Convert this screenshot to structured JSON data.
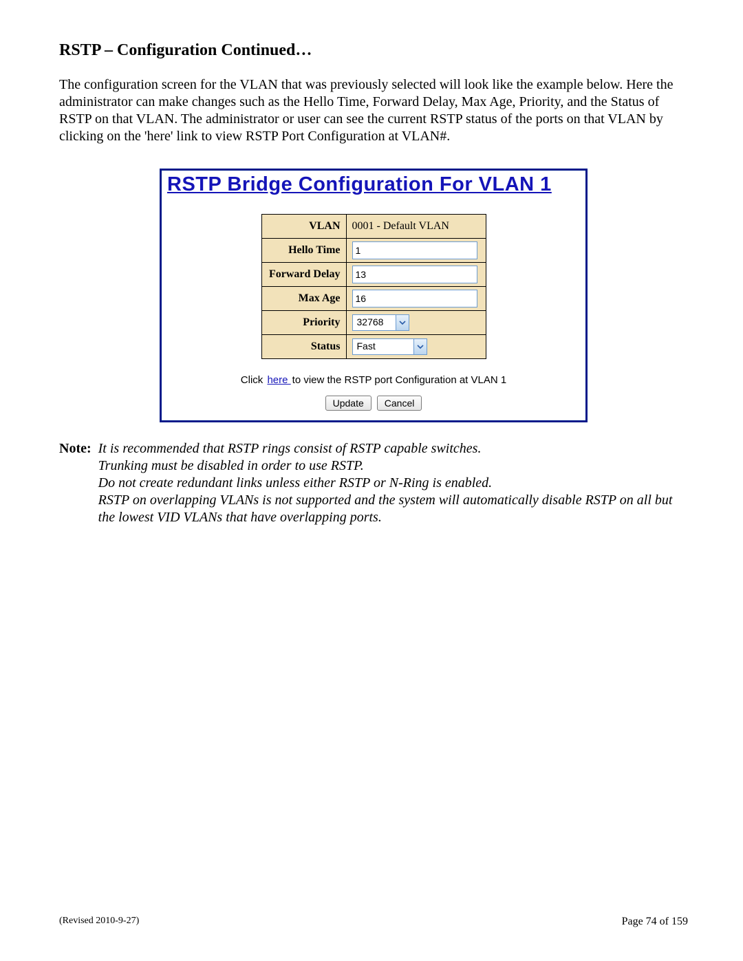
{
  "heading": "RSTP – Configuration Continued…",
  "intro": "The configuration screen for the VLAN that was previously selected will look like the example below. Here the administrator can make changes such as the Hello Time, Forward Delay, Max Age, Priority, and the Status of RSTP on that VLAN. The administrator or user can see the current RSTP status of the ports on that VLAN by clicking on the 'here' link to view RSTP Port Configuration at VLAN#.",
  "panel": {
    "title": "RSTP Bridge Configuration For VLAN 1",
    "rows": {
      "vlan_label": "VLAN",
      "vlan_value": "0001 - Default VLAN",
      "hello_label": "Hello Time",
      "hello_value": "1",
      "fwd_label": "Forward Delay",
      "fwd_value": "13",
      "maxage_label": "Max Age",
      "maxage_value": "16",
      "priority_label": "Priority",
      "priority_value": "32768",
      "status_label": "Status",
      "status_value": "Fast"
    },
    "port_line_prefix": "Click ",
    "port_line_link": " here ",
    "port_line_suffix": " to view the RSTP port Configuration at VLAN 1",
    "update_label": "Update",
    "cancel_label": "Cancel"
  },
  "note": {
    "label": "Note:",
    "lines": [
      "It is recommended that RSTP rings consist of RSTP capable switches.",
      "Trunking must be disabled in order to use RSTP.",
      "Do not create redundant links unless either RSTP or N-Ring is enabled.",
      "RSTP on overlapping VLANs is not supported and the system will automatically disable RSTP on all but the lowest VID VLANs that have overlapping ports."
    ]
  },
  "footer": {
    "revised": "(Revised 2010-9-27)",
    "page": "Page 74 of 159"
  }
}
